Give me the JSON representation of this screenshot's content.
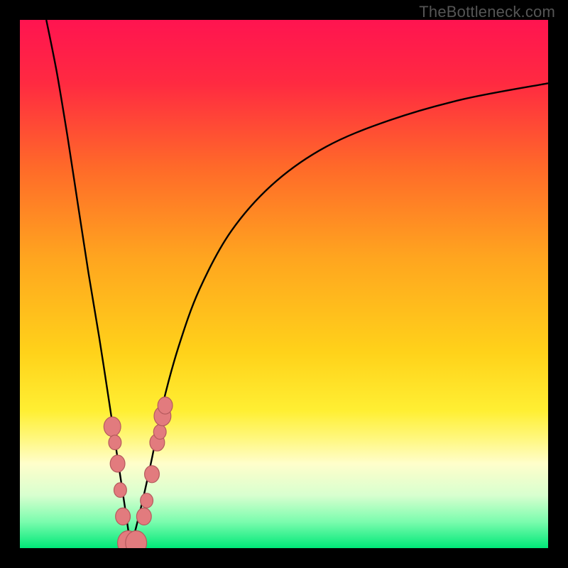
{
  "attribution": "TheBottleneck.com",
  "colors": {
    "gradient_stops": [
      {
        "offset": 0.0,
        "color": "#ff1450"
      },
      {
        "offset": 0.12,
        "color": "#ff2a41"
      },
      {
        "offset": 0.28,
        "color": "#ff6a29"
      },
      {
        "offset": 0.45,
        "color": "#ffa51f"
      },
      {
        "offset": 0.63,
        "color": "#ffd21a"
      },
      {
        "offset": 0.74,
        "color": "#ffef33"
      },
      {
        "offset": 0.79,
        "color": "#fff77a"
      },
      {
        "offset": 0.84,
        "color": "#fffecb"
      },
      {
        "offset": 0.9,
        "color": "#d8ffcf"
      },
      {
        "offset": 0.95,
        "color": "#7bfcae"
      },
      {
        "offset": 1.0,
        "color": "#00e878"
      }
    ],
    "curve": "#000000",
    "dot_fill": "#e27b7e",
    "dot_stroke": "#b55a5d",
    "frame": "#000000"
  },
  "chart_data": {
    "type": "line",
    "title": "",
    "xlabel": "",
    "ylabel": "",
    "xlim": [
      0,
      100
    ],
    "ylim": [
      0,
      100
    ],
    "note": "Two-branch bottleneck curve; y estimated as % height from bottom, x as % width from left. Minimum near x≈21.",
    "series": [
      {
        "name": "left-branch",
        "x": [
          5,
          7,
          9,
          11,
          13,
          15,
          17,
          18.5,
          20,
          21
        ],
        "y": [
          100,
          90,
          78,
          65,
          52,
          40,
          27,
          17,
          7,
          0
        ]
      },
      {
        "name": "right-branch",
        "x": [
          21,
          23,
          25,
          27,
          30,
          34,
          40,
          48,
          58,
          70,
          84,
          100
        ],
        "y": [
          0,
          8,
          17,
          27,
          38,
          49,
          60,
          69,
          76,
          81,
          85,
          88
        ]
      }
    ],
    "scatter": {
      "name": "highlight-dots",
      "x": [
        17.5,
        18.0,
        18.5,
        19.0,
        19.5,
        20.5,
        22.0,
        23.5,
        24.0,
        25.0,
        26.0,
        26.5,
        27.0,
        27.5
      ],
      "y": [
        23,
        20,
        16,
        11,
        6,
        1,
        1,
        6,
        9,
        14,
        20,
        22,
        25,
        27
      ],
      "r_percent": [
        1.6,
        1.2,
        1.4,
        1.2,
        1.4,
        2.0,
        2.0,
        1.4,
        1.2,
        1.4,
        1.4,
        1.2,
        1.6,
        1.4
      ]
    }
  }
}
